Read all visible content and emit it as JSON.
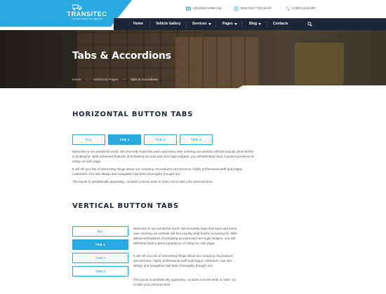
{
  "brand": {
    "name": "TRANSITEC",
    "tagline": "Transportation & Logistics",
    "color": "#29a9e0",
    "nav_bg": "#1d2637"
  },
  "contact": {
    "email": "info@demolink.org",
    "hours": "Mon-Sat: 7:00-19:00",
    "phone": "1-800-1234-567"
  },
  "nav": {
    "items": [
      {
        "label": "Home",
        "dropdown": false
      },
      {
        "label": "Vehicle Gallery",
        "dropdown": false
      },
      {
        "label": "Services",
        "dropdown": true
      },
      {
        "label": "Pages",
        "dropdown": true
      },
      {
        "label": "Blog",
        "dropdown": true
      },
      {
        "label": "Contacts",
        "dropdown": false
      }
    ],
    "search_icon": "search-icon"
  },
  "hero": {
    "title": "Tabs & Accordions",
    "breadcrumb": [
      "Home",
      "Additional Pages",
      "Tabs & Accordions"
    ]
  },
  "horizontal": {
    "title": "HORIZONTAL BUTTON TABS",
    "tabs": [
      "ALL",
      "TAB 1",
      "TAB 2",
      "TAB 3"
    ],
    "active_index": 1,
    "paragraphs": [
      "Welcome to our wonderful world. We sincerely hope that each and every user entering our website will find exactly what he/she is looking for. With advanced features of activating account and new login widgets, you will definitely have a great experience of using our web page.",
      "It will tell you lots of interesting things about our company, its products and services, highly professional staff and happy customers. Our site design and navigation has been thoroughly thought out.",
      "The layout is aesthetically appealing, contains concise texts in order not to take your precious time."
    ]
  },
  "vertical": {
    "title": "VERTICAL BUTTON TABS",
    "tabs": [
      "ALL",
      "TAB 1",
      "TAB 2",
      "TAB 3"
    ],
    "active_index": 1,
    "paragraphs": [
      "Welcome to our wonderful world. We sincerely hope that each and every user entering our website will find exactly what he/she is looking for. With advanced features of activating account and new login widgets, you will definitely have a great experience of using our web page.",
      "It will tell you lots of interesting things about our company, its products and services, highly professional staff and happy customers. Our site design and navigation has been thoroughly thought out.",
      "The layout is aesthetically appealing, contains concise texts in order not to take your precious time."
    ]
  }
}
